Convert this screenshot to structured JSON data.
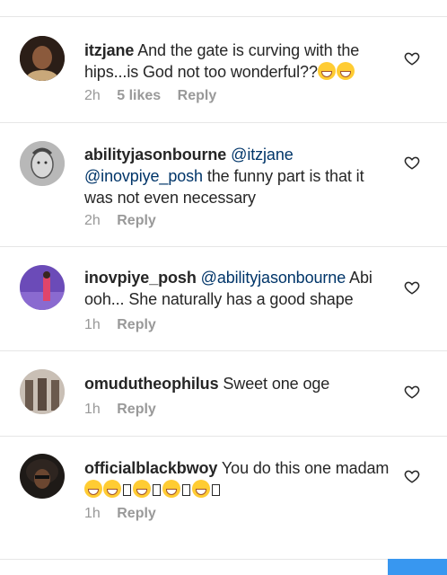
{
  "comments": [
    {
      "username": "itzjane",
      "parts": [
        " And the gate is curving with the hips...is God not too wonderful??"
      ],
      "time": "2h",
      "likes": "5 likes",
      "reply": "Reply",
      "avatar_color": "#3a2a22"
    },
    {
      "username": "abilityjasonbourne",
      "mention1": "@itzjane",
      "mention2": "@inovpiye_posh",
      "rest": " the funny part is that it was not even necessary",
      "time": "2h",
      "reply": "Reply",
      "avatar_color": "#9e9e9e"
    },
    {
      "username": "inovpiye_posh",
      "mention1": "@abilityjasonbourne",
      "rest": " Abi ooh... She naturally has a good shape",
      "time": "1h",
      "reply": "Reply",
      "avatar_color": "#6b4bb8"
    },
    {
      "username": "omudutheophilus",
      "rest": " Sweet one oge",
      "time": "1h",
      "reply": "Reply",
      "avatar_color": "#8a7a70"
    },
    {
      "username": "officialblackbwoy",
      "rest": " You do this one madam ",
      "time": "1h",
      "reply": "Reply",
      "avatar_color": "#1e1a17"
    }
  ],
  "colors": {
    "text": "#262626",
    "meta": "#999999",
    "divider": "#e6e6e6",
    "mention": "#003569",
    "button": "#3897f0"
  },
  "icons": {
    "like": "heart-outline-icon"
  }
}
